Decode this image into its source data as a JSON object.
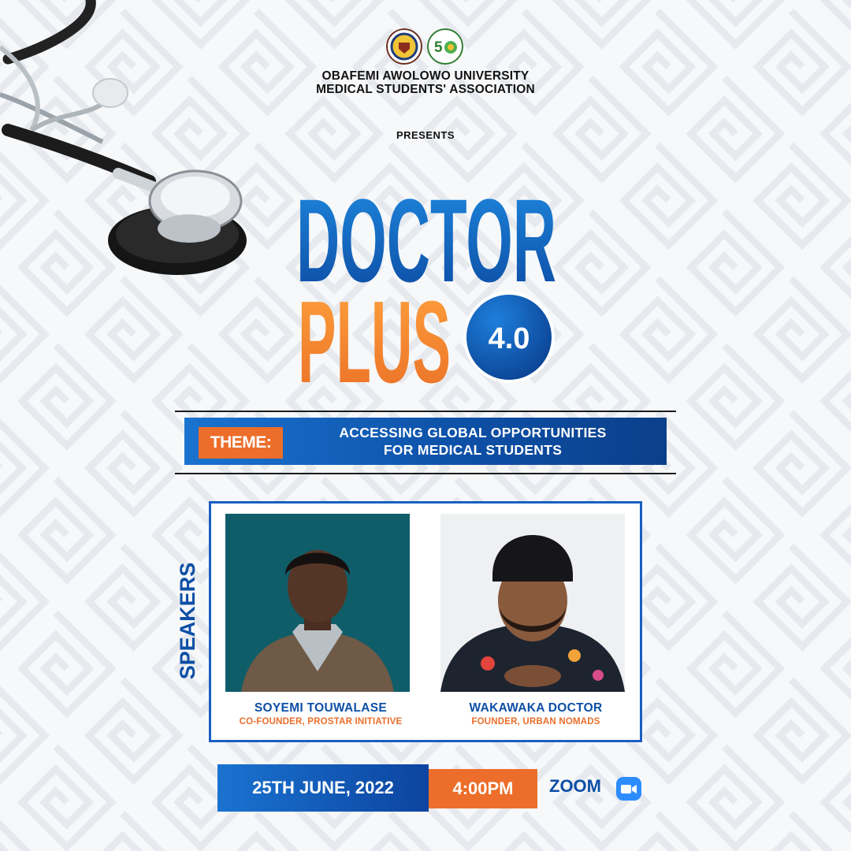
{
  "organization": {
    "line1": "OBAFEMI AWOLOWO UNIVERSITY",
    "line2": "MEDICAL STUDENTS' ASSOCIATION",
    "logos": [
      "university-crest-logo",
      "50th-anniversary-logo"
    ]
  },
  "presents": "PRESENTS",
  "event": {
    "title_line1": "DOCTOR",
    "title_line2": "PLUS",
    "edition": "4.0"
  },
  "theme": {
    "label": "THEME:",
    "line1": "ACCESSING GLOBAL OPPORTUNITIES",
    "line2": "FOR MEDICAL STUDENTS"
  },
  "speakers": {
    "heading": "SPEAKERS",
    "items": [
      {
        "name": "SOYEMI TOUWALASE",
        "role": "CO-FOUNDER, PROSTAR INITIATIVE"
      },
      {
        "name": "WAKAWAKA DOCTOR",
        "role": "FOUNDER, URBAN NOMADS"
      }
    ]
  },
  "schedule": {
    "date": "25TH JUNE, 2022",
    "time": "4:00PM",
    "platform": "ZOOM",
    "platform_icon": "zoom-video-icon"
  },
  "colors": {
    "blue": "#0d4fa5",
    "blue_light": "#1a73d0",
    "orange": "#ec6e2a",
    "dark": "#121212"
  }
}
